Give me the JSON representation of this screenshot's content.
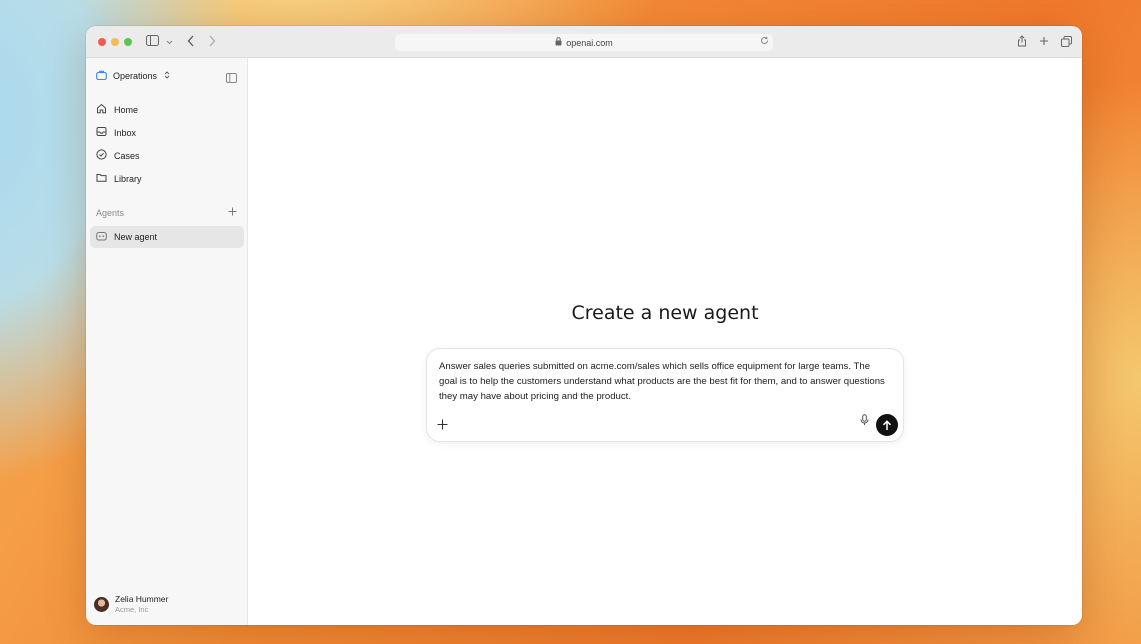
{
  "browser": {
    "url": "openai.com"
  },
  "sidebar": {
    "workspace_label": "Operations",
    "nav_items": [
      {
        "label": "Home",
        "icon": "home-icon"
      },
      {
        "label": "Inbox",
        "icon": "inbox-icon"
      },
      {
        "label": "Cases",
        "icon": "check-circle-icon"
      },
      {
        "label": "Library",
        "icon": "folder-icon"
      }
    ],
    "agents_section_label": "Agents",
    "agents": [
      {
        "label": "New agent",
        "icon": "bot-icon"
      }
    ],
    "user": {
      "name": "Zelia Hummer",
      "org": "Acme, Inc"
    }
  },
  "main": {
    "heading": "Create a new agent",
    "composer": {
      "prompt_text": "Answer sales queries submitted on acme.com/sales which sells office equipment for large teams. The goal is to help the customers understand what products are the best fit for them, and to answer questions they may have about pricing and the product."
    }
  },
  "colors": {
    "workspace_icon": "#3b82f6",
    "send_button": "#111111",
    "selected_item_bg": "#e6e6e6"
  }
}
